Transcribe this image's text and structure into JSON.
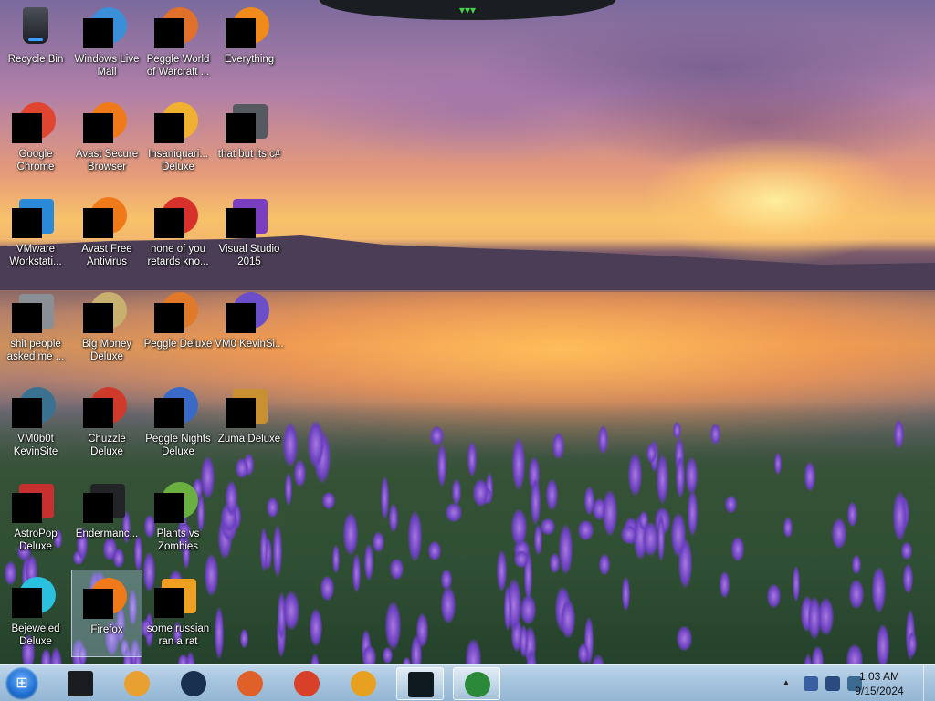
{
  "desktop": {
    "icons": [
      {
        "label": "Recycle Bin",
        "glyph": "recycle-bin-icon",
        "color": "#2a2e36"
      },
      {
        "label": "Windows Live Mail",
        "glyph": "windows-live-mail-icon",
        "color": "#3a8fd8"
      },
      {
        "label": "Peggle World of Warcraft ...",
        "glyph": "peggle-wow-icon",
        "color": "#e0702a"
      },
      {
        "label": "Everything",
        "glyph": "everything-search-icon",
        "color": "#f08a1a"
      },
      {
        "label": "Google Chrome",
        "glyph": "chrome-icon",
        "color": "#e0452f"
      },
      {
        "label": "Avast Secure Browser",
        "glyph": "avast-secure-browser-icon",
        "color": "#f07a1a"
      },
      {
        "label": "Insaniquari... Deluxe",
        "glyph": "insaniquarium-icon",
        "color": "#f0b030"
      },
      {
        "label": "that but its c#",
        "glyph": "shortcut-icon",
        "color": "#555a60"
      },
      {
        "label": "VMware Workstati...",
        "glyph": "vmware-icon",
        "color": "#2a8ad8"
      },
      {
        "label": "Avast Free Antivirus",
        "glyph": "avast-antivirus-icon",
        "color": "#f07a1a"
      },
      {
        "label": "none of you retards kno...",
        "glyph": "shortcut-red-icon",
        "color": "#d8302a"
      },
      {
        "label": "Visual Studio 2015",
        "glyph": "visual-studio-icon",
        "color": "#7a3fc0"
      },
      {
        "label": "shit people asked me ...",
        "glyph": "folder-icon",
        "color": "#8a8f95"
      },
      {
        "label": "Big Money Deluxe",
        "glyph": "big-money-icon",
        "color": "#c8b070"
      },
      {
        "label": "Peggle Deluxe",
        "glyph": "peggle-deluxe-icon",
        "color": "#e07a2a"
      },
      {
        "label": "VM0 KevinSi...",
        "glyph": "vm-shortcut-icon",
        "color": "#6a4fc8"
      },
      {
        "label": "VM0b0t KevinSite",
        "glyph": "vm-bot-icon",
        "color": "#3a7090"
      },
      {
        "label": "Chuzzle Deluxe",
        "glyph": "chuzzle-icon",
        "color": "#d03a2a"
      },
      {
        "label": "Peggle Nights Deluxe",
        "glyph": "peggle-nights-icon",
        "color": "#3a6ac8"
      },
      {
        "label": "Zuma Deluxe",
        "glyph": "zuma-icon",
        "color": "#c89030"
      },
      {
        "label": "AstroPop Deluxe",
        "glyph": "astropop-icon",
        "color": "#c83030"
      },
      {
        "label": "Endermanc...",
        "glyph": "console-icon",
        "color": "#222428"
      },
      {
        "label": "Plants vs Zombies",
        "glyph": "plants-vs-zombies-icon",
        "color": "#6ab040"
      },
      {
        "label": "Bejeweled Deluxe",
        "glyph": "bejeweled-icon",
        "color": "#2ac0e0"
      },
      {
        "label": "Firefox",
        "glyph": "firefox-icon",
        "color": "#f07a1a"
      },
      {
        "label": "some russian ran a rat",
        "glyph": "edit-document-icon",
        "color": "#f0a020"
      }
    ]
  },
  "taskbar": {
    "start_label": "⊞",
    "buttons": [
      {
        "name": "media-player-icon",
        "color": "#1a1c20"
      },
      {
        "name": "windows-media-center-icon",
        "color": "#e8a030"
      },
      {
        "name": "globe-icon",
        "color": "#1a3050"
      },
      {
        "name": "firefox-icon",
        "color": "#e0602a"
      },
      {
        "name": "chrome-icon",
        "color": "#d8402a"
      },
      {
        "name": "avast-browser-icon",
        "color": "#e8a020"
      },
      {
        "name": "task-manager-icon",
        "color": "#0e1a20"
      },
      {
        "name": "ie-download-icon",
        "color": "#2a8a3a"
      }
    ],
    "clock_time": "1:03 AM",
    "clock_date": "9/15/2024",
    "tray_colors": [
      "#3a5fa0",
      "#2a4a80",
      "#3a6a90"
    ]
  }
}
